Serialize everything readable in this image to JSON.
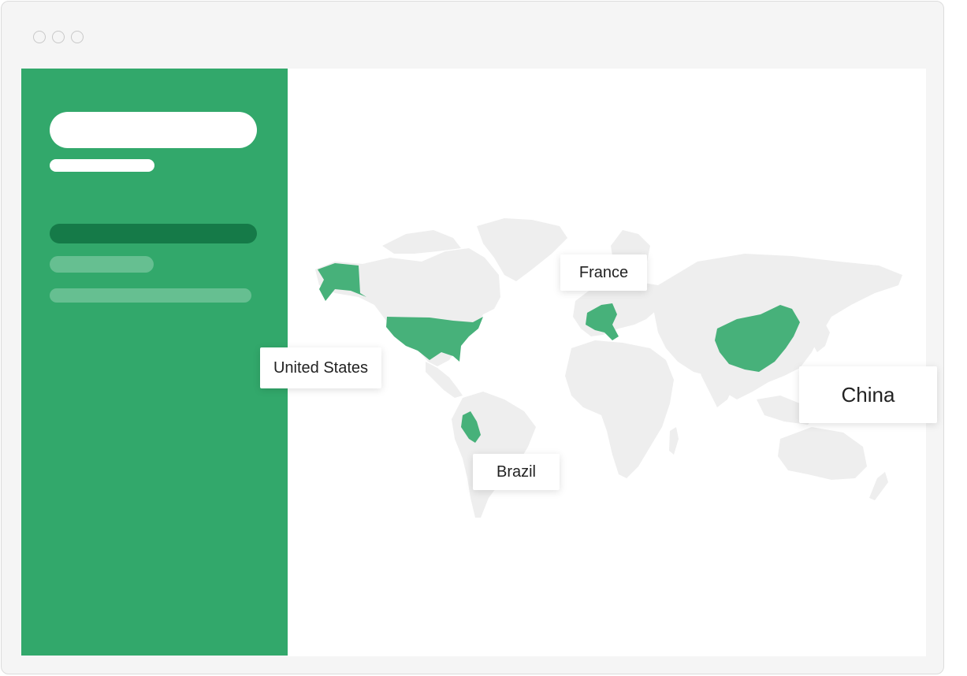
{
  "window": {
    "controls": [
      "close",
      "minimize",
      "maximize"
    ]
  },
  "sidebar": {
    "color": "#32a86b",
    "active_color": "#157a48",
    "items": [
      "title-placeholder",
      "subtitle-placeholder",
      "nav-item-active",
      "nav-item-2",
      "nav-item-3"
    ]
  },
  "map": {
    "land_color": "#eeeeee",
    "highlight_color": "#47b17a",
    "highlighted_countries": [
      "United States",
      "France",
      "Brazil",
      "China"
    ],
    "labels": {
      "united_states": "United States",
      "france": "France",
      "brazil": "Brazil",
      "china": "China"
    }
  }
}
